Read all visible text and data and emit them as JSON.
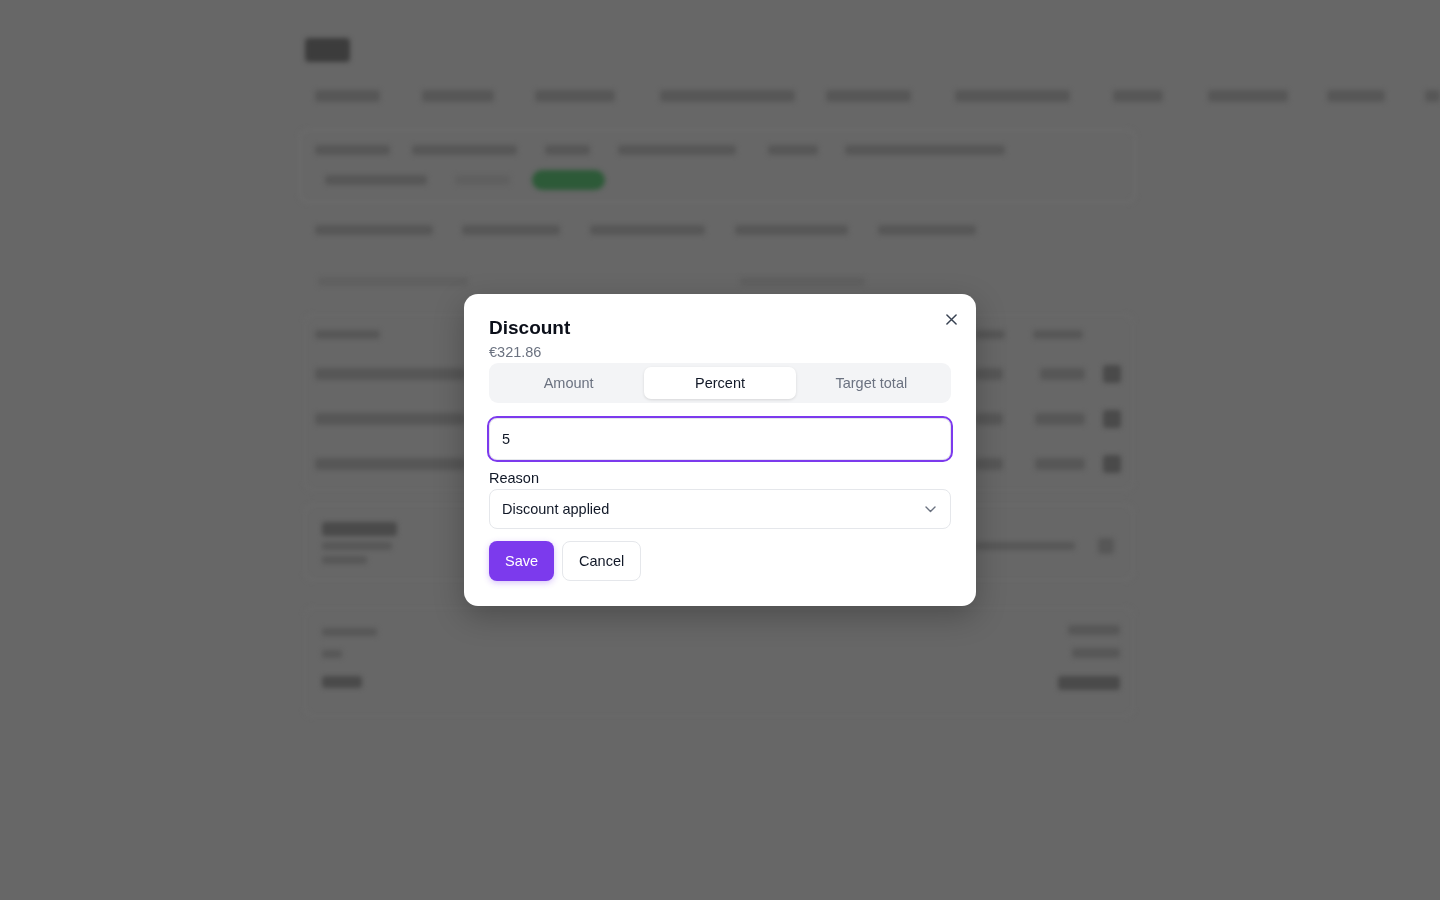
{
  "dialog": {
    "title": "Discount",
    "subtitle": "€321.86",
    "mode_tabs": [
      {
        "label": "Amount",
        "selected": false
      },
      {
        "label": "Percent",
        "selected": true
      },
      {
        "label": "Target total",
        "selected": false
      }
    ],
    "value_field": {
      "value": "5",
      "focused": true
    },
    "reason": {
      "label": "Reason",
      "value": "Discount applied"
    },
    "buttons": [
      {
        "label": "Save",
        "kind": "primary"
      },
      {
        "label": "Cancel",
        "kind": "secondary"
      }
    ]
  }
}
